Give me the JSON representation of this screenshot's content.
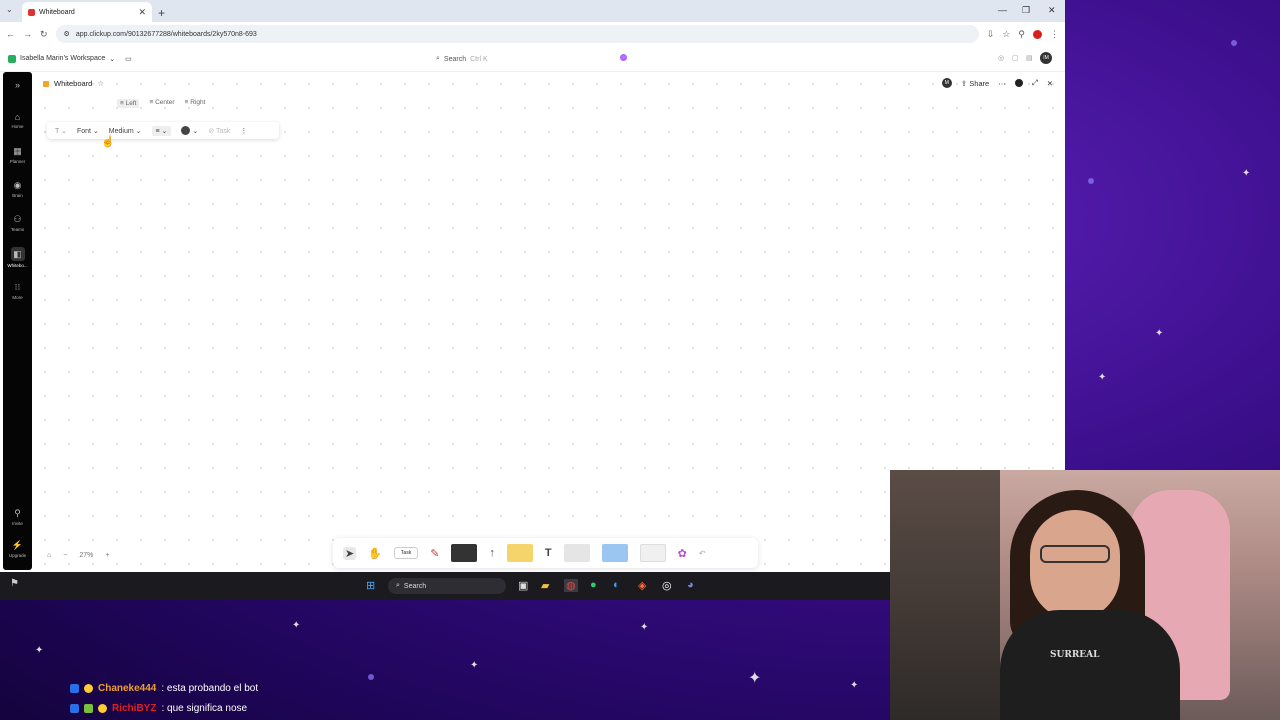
{
  "browser": {
    "tab_title": "Whiteboard",
    "url": "app.clickup.com/90132677288/whiteboards/2ky570n8-693"
  },
  "topbar": {
    "workspace_name": "Isabella Marin's Workspace",
    "search_placeholder": "Search",
    "search_shortcut": "Ctrl K",
    "avatar_initials": "IM"
  },
  "sidebar": {
    "items": [
      {
        "label": "Home",
        "icon": "home-icon"
      },
      {
        "label": "Planner",
        "icon": "calendar-icon"
      },
      {
        "label": "Brain",
        "icon": "brain-icon"
      },
      {
        "label": "Teams",
        "icon": "teams-icon"
      },
      {
        "label": "Whitebo...",
        "icon": "whiteboard-icon"
      },
      {
        "label": "More",
        "icon": "grid-icon"
      }
    ],
    "bottom": [
      {
        "label": "Invite",
        "icon": "invite-icon"
      },
      {
        "label": "Upgrade",
        "icon": "upgrade-icon"
      }
    ]
  },
  "whiteboard": {
    "title": "Whiteboard",
    "share_label": "Share",
    "share_avatar": "M",
    "align_options": [
      "Left",
      "Center",
      "Right"
    ],
    "selected_align": "Left",
    "format": {
      "font_label": "Font",
      "size_label": "Medium",
      "task_label": "Task"
    },
    "zoom": "27%"
  },
  "toolbox": {
    "task_label": "Task",
    "text_tool": "T"
  },
  "taskbar": {
    "search_label": "Search"
  },
  "webcam": {
    "shirt_text": "SURREAL"
  },
  "chat": [
    {
      "user": "Chaneke444",
      "message": ": esta probando el bot",
      "color": "#f0a030"
    },
    {
      "user": "RichiBYZ",
      "message": ": que significa nose",
      "color": "#e02020"
    }
  ]
}
